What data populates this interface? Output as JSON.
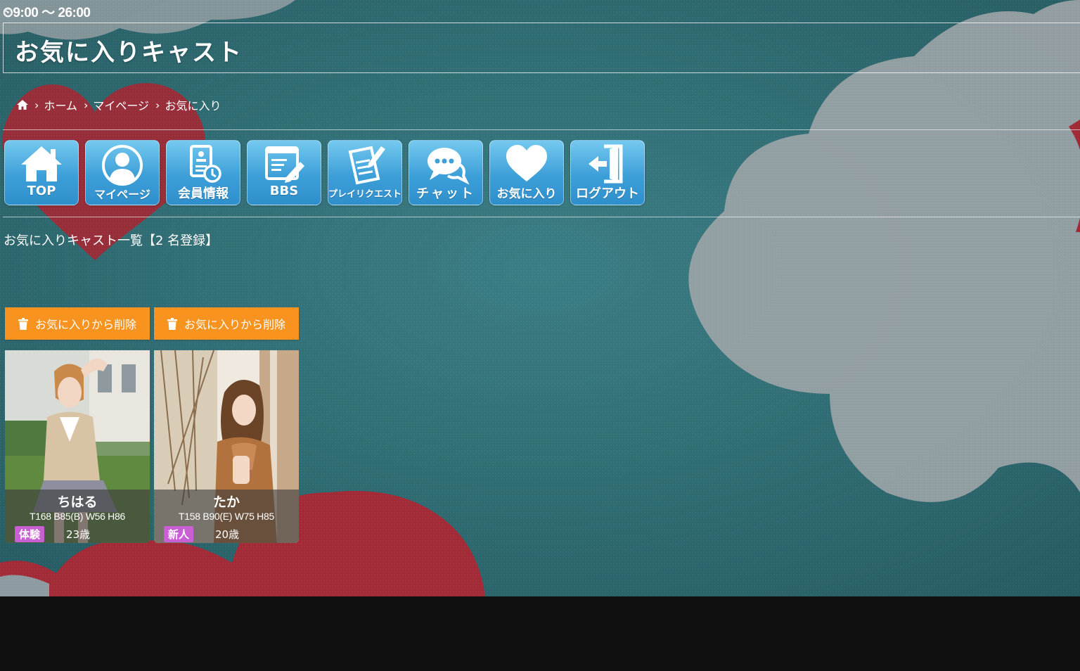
{
  "header": {
    "hours": "⏲9:00 〜 26:00",
    "title": "お気に入りキャスト"
  },
  "breadcrumb": {
    "items": [
      "ホーム",
      "マイページ",
      "お気に入り"
    ]
  },
  "nav": {
    "items": [
      {
        "label": "TOP",
        "icon": "home-icon"
      },
      {
        "label": "マイページ",
        "icon": "user-icon"
      },
      {
        "label": "会員情報",
        "icon": "member-info-icon"
      },
      {
        "label": "BBS",
        "icon": "bbs-icon"
      },
      {
        "label": "プレイリクエスト",
        "icon": "request-icon"
      },
      {
        "label": "チャット",
        "icon": "chat-icon"
      },
      {
        "label": "お気に入り",
        "icon": "heart-icon"
      },
      {
        "label": "ログアウト",
        "icon": "logout-icon"
      }
    ]
  },
  "favorites": {
    "heading": "お気に入りキャスト一覧【2 名登録】",
    "remove_label": "お気に入りから削除",
    "casts": [
      {
        "name": "ちはる",
        "sizes": "T168 B85(B) W56 H86",
        "badge": "体験",
        "age": "23歳"
      },
      {
        "name": "たか",
        "sizes": "T158 B90(E) W75 H85",
        "badge": "新人",
        "age": "20歳"
      }
    ]
  },
  "colors": {
    "accent_orange": "#f7931e",
    "nav_blue": "#3d9fd8",
    "badge_purple": "#c85fd3",
    "background_teal": "#2f6b72"
  }
}
